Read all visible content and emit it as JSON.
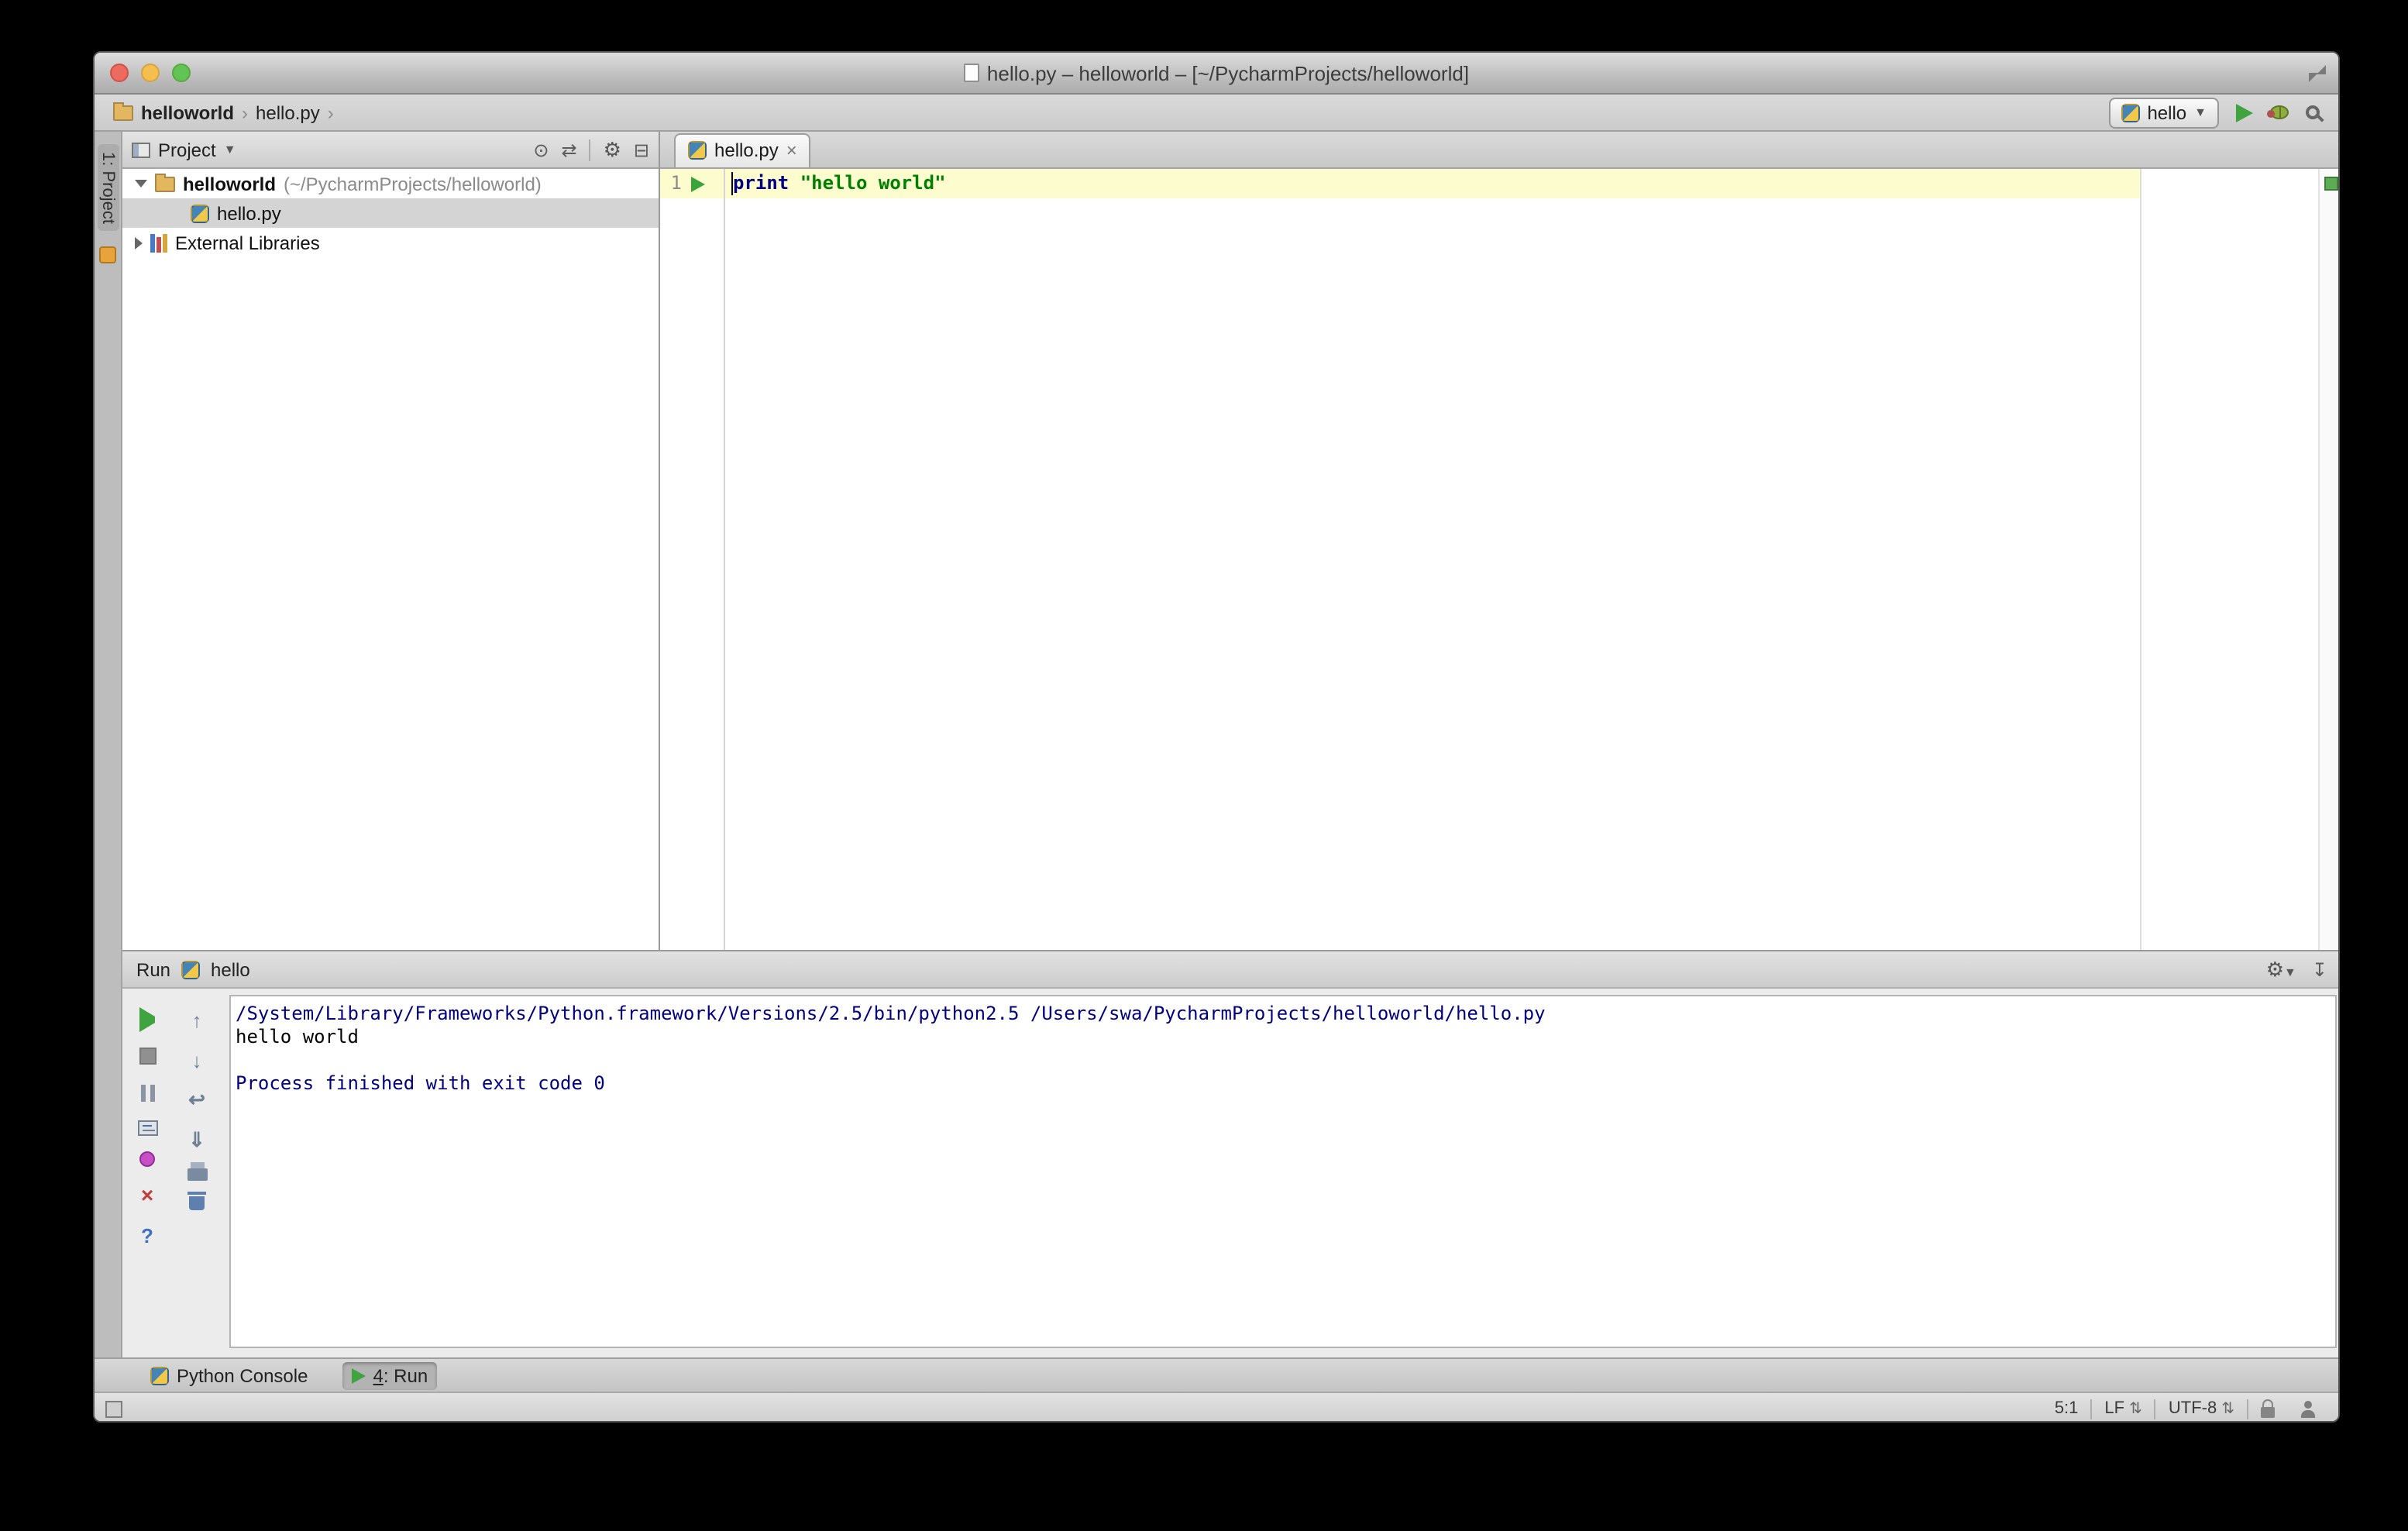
{
  "colors": {
    "keyword": "#000080",
    "string": "#008000",
    "console_info": "#000080",
    "run_green": "#3fa33f",
    "line_highlight": "#fcfccf",
    "selection_gray": "#d4d4d4"
  },
  "titlebar": {
    "title": "hello.py – helloworld – [~/PycharmProjects/helloworld]"
  },
  "navbar": {
    "breadcrumb": [
      {
        "label": "helloworld"
      },
      {
        "label": "hello.py"
      }
    ],
    "run_config": {
      "label": "hello"
    }
  },
  "tool_strip": {
    "label": "1: Project"
  },
  "project": {
    "header": {
      "title": "Project"
    },
    "tree": {
      "root_name": "helloworld",
      "root_path": "(~/PycharmProjects/helloworld)",
      "file": "hello.py",
      "external": "External Libraries"
    }
  },
  "editor": {
    "tab_label": "hello.py",
    "tab_close": "×",
    "line_number": "1",
    "code_keyword": "print",
    "code_string": "\"hello world\""
  },
  "run": {
    "title": "Run",
    "config": "hello",
    "console": {
      "command": "/System/Library/Frameworks/Python.framework/Versions/2.5/bin/python2.5 /Users/swa/PycharmProjects/helloworld/hello.py",
      "stdout": "hello world",
      "exit": "Process finished with exit code 0"
    }
  },
  "bottom_bar": {
    "python_console": "Python Console",
    "run_tab_number": "4",
    "run_tab_label": ": Run"
  },
  "status_bar": {
    "caret": "5:1",
    "line_sep": "LF",
    "encoding": "UTF-8"
  }
}
